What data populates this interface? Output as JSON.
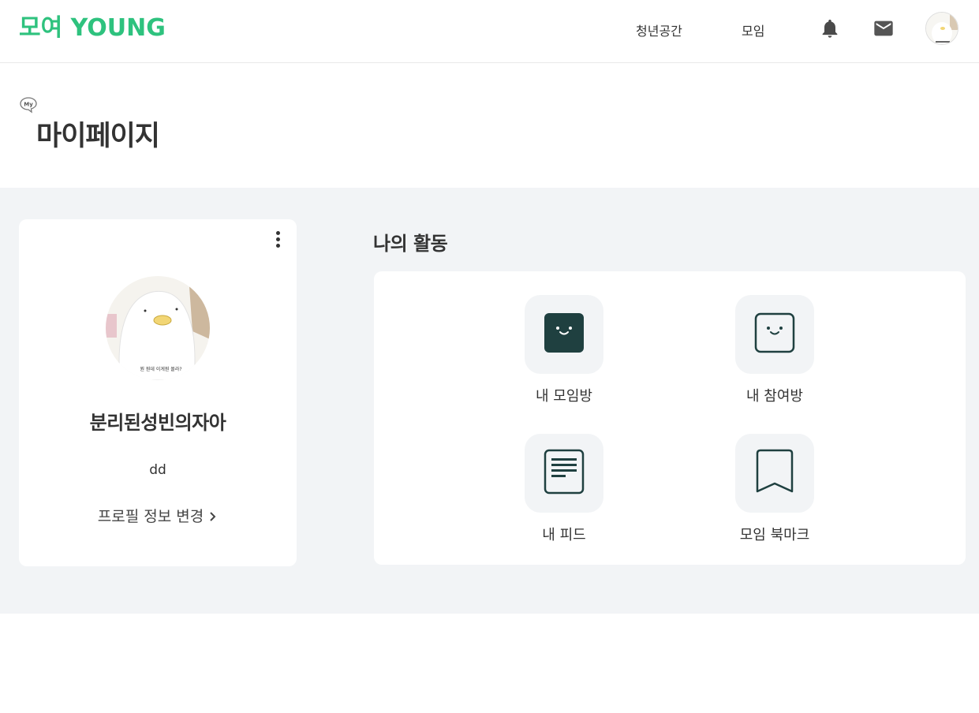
{
  "header": {
    "logo_text": "모여 YOUNG",
    "nav": [
      {
        "label": "청년공간"
      },
      {
        "label": "모임"
      }
    ],
    "icons": [
      "bell-icon",
      "mail-icon",
      "avatar"
    ]
  },
  "page": {
    "badge": "My",
    "title": "마이페이지"
  },
  "profile": {
    "name": "분리된성빈의자아",
    "bio": "dd",
    "edit_link": "프로필 정보 변경",
    "avatar_caption": "뭔 뭔데 이게뭔 몰라?"
  },
  "activity": {
    "title": "나의 활동",
    "items": [
      {
        "label": "내 모임방",
        "icon": "smile-box-filled-icon"
      },
      {
        "label": "내 참여방",
        "icon": "smile-box-outline-icon"
      },
      {
        "label": "내 피드",
        "icon": "document-icon"
      },
      {
        "label": "모임 북마크",
        "icon": "bookmark-icon"
      }
    ]
  },
  "colors": {
    "brand": "#2ec27e",
    "icon_dark": "#1f4040",
    "section_bg": "#f2f4f6"
  }
}
